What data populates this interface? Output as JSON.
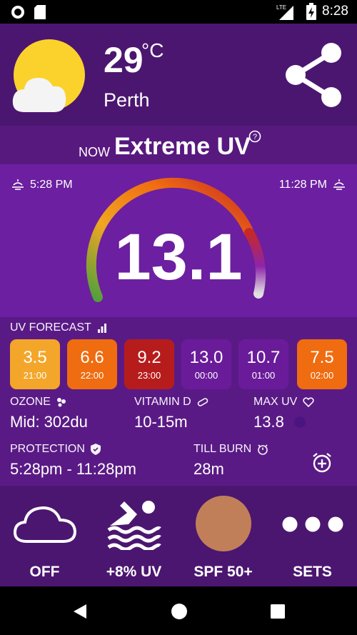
{
  "status_bar": {
    "network": "LTE",
    "time": "8:28"
  },
  "header": {
    "temperature": "29",
    "unit": "°C",
    "city": "Perth"
  },
  "now": {
    "label": "NOW",
    "status": "Extreme UV"
  },
  "gauge": {
    "sunrise_time": "5:28 PM",
    "sunset_time": "11:28 PM",
    "uv_index": "13.1"
  },
  "forecast": {
    "title": "UV FORECAST",
    "items": [
      {
        "value": "3.5",
        "time": "21:00",
        "color": "#f4a62a"
      },
      {
        "value": "6.6",
        "time": "22:00",
        "color": "#ef6c10"
      },
      {
        "value": "9.2",
        "time": "23:00",
        "color": "#b71c1c"
      },
      {
        "value": "13.0",
        "time": "00:00",
        "color": "#6a1b9a"
      },
      {
        "value": "10.7",
        "time": "01:00",
        "color": "#6a1b9a"
      },
      {
        "value": "7.5",
        "time": "02:00",
        "color": "#ef6c10"
      }
    ]
  },
  "stats": {
    "ozone_label": "OZONE",
    "ozone_value": "Mid: 302du",
    "vitamin_label": "VITAMIN D",
    "vitamin_value": "10-15m",
    "maxuv_label": "MAX UV",
    "maxuv_value": "13.8",
    "protection_label": "PROTECTION",
    "protection_value": "5:28pm - 11:28pm",
    "tillburn_label": "TILL BURN",
    "tillburn_value": "28m"
  },
  "bottom": {
    "cloud_label": "OFF",
    "swim_label": "+8% UV",
    "spf_label": "SPF 50+",
    "sets_label": "SETS",
    "skin_color": "#c17f59"
  }
}
